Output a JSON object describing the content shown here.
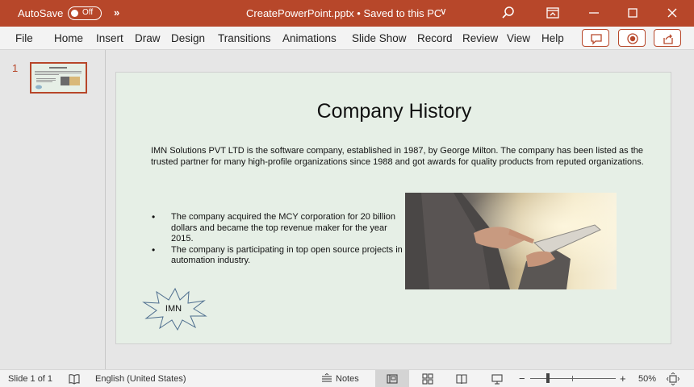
{
  "titlebar": {
    "autosave_label": "AutoSave",
    "autosave_state": "Off",
    "doc_title": "CreatePowerPoint.pptx • Saved to this PC",
    "doc_chevron": "∨",
    "more": "»"
  },
  "ribbon": {
    "tabs": [
      "File",
      "Home",
      "Insert",
      "Draw",
      "Design",
      "Transitions",
      "Animations",
      "Slide Show",
      "Record",
      "Review",
      "View",
      "Help"
    ]
  },
  "thumbnails": {
    "number": "1"
  },
  "slide": {
    "title": "Company History",
    "paragraph": "IMN Solutions PVT LTD is the software company, established in 1987, by George Milton. The company has been listed as the trusted partner for many high-profile organizations since 1988 and got awards for quality products from reputed organizations.",
    "bullets": [
      "The company acquired the MCY corporation for 20 billion dollars and became the top revenue maker for the year 2015.",
      "The company is participating in top open source projects in automation industry."
    ],
    "shape_text": "IMN"
  },
  "statusbar": {
    "slide_count": "Slide 1 of 1",
    "language": "English (United States)",
    "notes": "Notes",
    "zoom_minus": "−",
    "zoom_plus": "+",
    "zoom_level": "50%",
    "zoom_fraction": 0.21
  },
  "colors": {
    "accent": "#b7472a",
    "slide_background": "#e6efe6"
  }
}
